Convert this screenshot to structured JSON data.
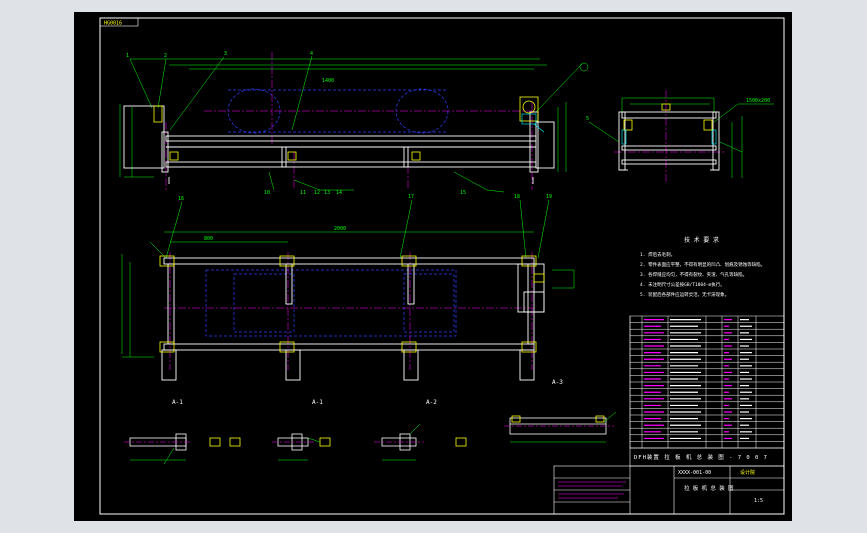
{
  "viewer": {
    "background": "#dfe3e8",
    "sheet_background": "#000000"
  },
  "drawing": {
    "corner_tag": "HG0016",
    "view_labels": [
      "A-1",
      "A-1",
      "A-2",
      "A-3"
    ],
    "spec_title": "技 术 要 求",
    "spec_lines": [
      "1. 焊后去毛刺。",
      "2. 零件表面应平整，不得有明显的凹凸、划痕及锈蚀等缺陷。",
      "3. 各焊缝应均匀，不得有裂纹、夹渣、气孔等缺陷。",
      "4. 未注明尺寸公差按GB/T1804-m执行。",
      "5. 装配后各部件应运转灵活，无卡滞现象。"
    ],
    "title_block": {
      "caption": "DFH装置 拉 板 机 总 装 图 - 7 0 0 7",
      "drawing_no": "XXXX-001-00",
      "scale": "1:5",
      "unit": "设计院",
      "name": "拉 板 机 总 装 图"
    }
  },
  "colors": {
    "white": "#ffffff",
    "yellow": "#ffff00",
    "green": "#00ff00",
    "magenta": "#ff00ff",
    "blue": "#3040ff",
    "cyan": "#00ffff",
    "red": "#ff2020"
  }
}
